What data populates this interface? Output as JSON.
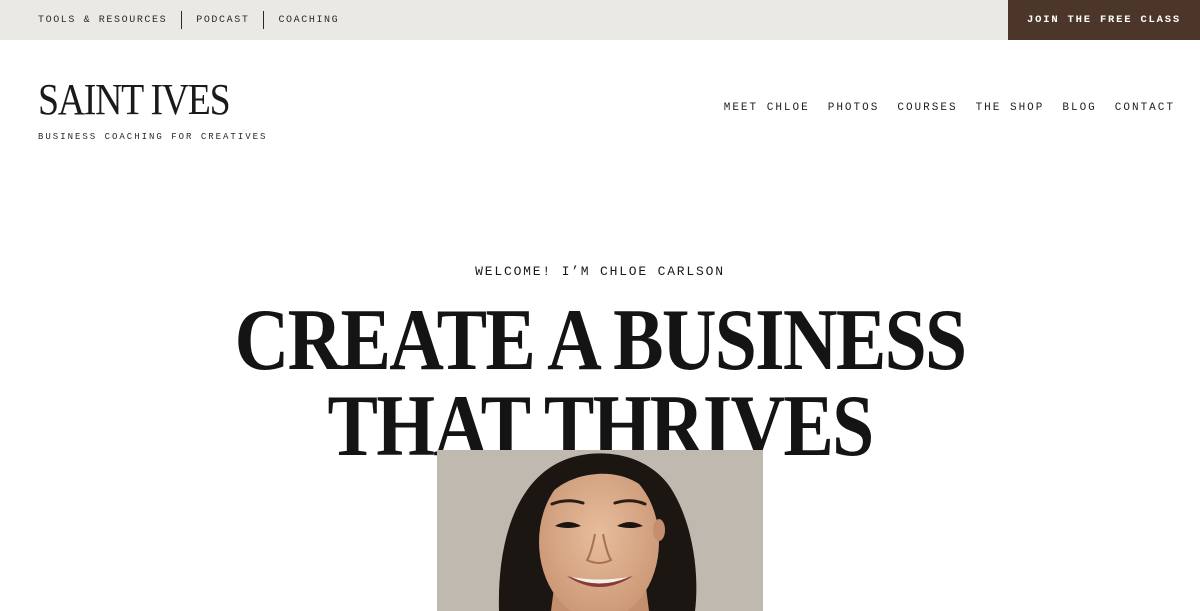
{
  "topbar": {
    "links": [
      "TOOLS & RESOURCES",
      "PODCAST",
      "COACHING"
    ],
    "cta_label": "JOIN THE FREE CLASS"
  },
  "header": {
    "logo_title": "SAINT IVES",
    "logo_tagline": "BUSINESS COACHING FOR CREATIVES",
    "nav": [
      "MEET CHLOE",
      "PHOTOS",
      "COURSES",
      "THE SHOP",
      "BLOG",
      "CONTACT"
    ]
  },
  "hero": {
    "eyebrow": "WELCOME! I’M CHLOE CARLSON",
    "headline_line1": "CREATE A BUSINESS",
    "headline_line2": "THAT THRIVES"
  },
  "colors": {
    "topbar_bg": "#ebe9e4",
    "cta_bg": "#4b3629",
    "text": "#1a1a1a"
  }
}
